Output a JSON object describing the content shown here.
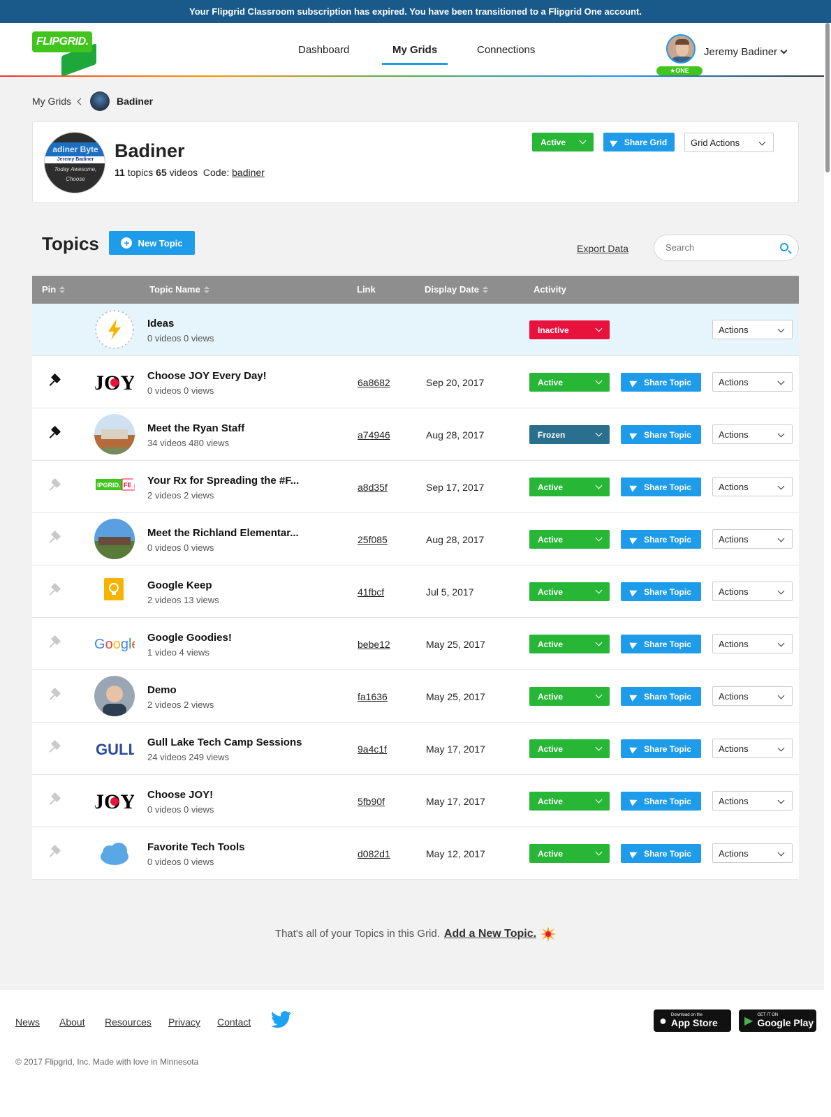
{
  "banner": {
    "text": "Your Flipgrid Classroom subscription has expired. You have been transitioned to a Flipgrid One account."
  },
  "header": {
    "logo": "FLIPGRID.",
    "nav": [
      {
        "label": "Dashboard",
        "active": false
      },
      {
        "label": "My Grids",
        "active": true
      },
      {
        "label": "Connections",
        "active": false
      }
    ],
    "user": {
      "name": "Jeremy Badiner",
      "badge": "★ONE"
    }
  },
  "breadcrumb": {
    "root": "My Grids",
    "current": "Badiner"
  },
  "grid": {
    "title": "Badiner",
    "topics_count": "11",
    "topics_label": "topics",
    "videos_count": "65",
    "videos_label": "videos",
    "code_label": "Code:",
    "code": "badiner",
    "avatar_line1": "adiner Byte",
    "avatar_line2": "Jeremy Badiner",
    "avatar_line3": "Today Awesome, Choose",
    "status": "Active",
    "share_label": "Share Grid",
    "actions_label": "Grid Actions"
  },
  "topics_section": {
    "title": "Topics",
    "new_topic_label": "New Topic",
    "export_label": "Export Data",
    "search_placeholder": "Search",
    "columns": {
      "pin": "Pin",
      "name": "Topic Name",
      "link": "Link",
      "date": "Display Date",
      "activity": "Activity"
    },
    "share_label": "Share Topic",
    "actions_label": "Actions"
  },
  "topics": [
    {
      "name": "Ideas",
      "sub": "0 videos 0 views",
      "link": "",
      "date": "",
      "status": "Inactive",
      "pinned": false,
      "thumb": "lightning-icon",
      "share": false
    },
    {
      "name": "Choose JOY Every Day!",
      "sub": "0 videos 0 views",
      "link": "6a8682",
      "date": "Sep 20, 2017",
      "status": "Active",
      "pinned": true,
      "thumb": "joy-text",
      "share": true
    },
    {
      "name": "Meet the Ryan Staff",
      "sub": "34 videos 480 views",
      "link": "a74946",
      "date": "Aug 28, 2017",
      "status": "Frozen",
      "pinned": true,
      "thumb": "school-photo",
      "share": true
    },
    {
      "name": "Your Rx for Spreading the #F...",
      "sub": "2 videos 2 views",
      "link": "a8d35f",
      "date": "Sep 17, 2017",
      "status": "Active",
      "pinned": false,
      "thumb": "flipgrid-logo",
      "share": true
    },
    {
      "name": "Meet the Richland Elementar...",
      "sub": "0 videos 0 views",
      "link": "25f085",
      "date": "Aug 28, 2017",
      "status": "Active",
      "pinned": false,
      "thumb": "building-photo",
      "share": true
    },
    {
      "name": "Google Keep",
      "sub": "2 videos 13 views",
      "link": "41fbcf",
      "date": "Jul 5, 2017",
      "status": "Active",
      "pinned": false,
      "thumb": "keep-icon",
      "share": true
    },
    {
      "name": "Google Goodies!",
      "sub": "1 video 4 views",
      "link": "bebe12",
      "date": "May 25, 2017",
      "status": "Active",
      "pinned": false,
      "thumb": "google-logo",
      "share": true
    },
    {
      "name": "Demo",
      "sub": "2 videos 2 views",
      "link": "fa1636",
      "date": "May 25, 2017",
      "status": "Active",
      "pinned": false,
      "thumb": "person-photo",
      "share": true
    },
    {
      "name": "Gull Lake Tech Camp Sessions",
      "sub": "24 videos 249 views",
      "link": "9a4c1f",
      "date": "May 17, 2017",
      "status": "Active",
      "pinned": false,
      "thumb": "gull-lake-logo",
      "share": true
    },
    {
      "name": "Choose JOY!",
      "sub": "0 videos 0 views",
      "link": "5fb90f",
      "date": "May 17, 2017",
      "status": "Active",
      "pinned": false,
      "thumb": "joy-text",
      "share": true
    },
    {
      "name": "Favorite Tech Tools",
      "sub": "0 videos 0 views",
      "link": "d082d1",
      "date": "May 12, 2017",
      "status": "Active",
      "pinned": false,
      "thumb": "cloud-icon",
      "share": true
    }
  ],
  "end_message": {
    "text": "That's all of your Topics in this Grid.",
    "link": "Add a New Topic."
  },
  "footer": {
    "links": [
      "News",
      "About",
      "Resources",
      "Privacy",
      "Contact"
    ],
    "app_store_small": "Download on the",
    "app_store_big": "App Store",
    "google_play_small": "GET IT ON",
    "google_play_big": "Google Play",
    "copyright": "© 2017 Flipgrid, Inc. Made with love in Minnesota"
  },
  "colors": {
    "active": "#28b637",
    "inactive": "#e8123d",
    "frozen": "#2a6f8d",
    "accent": "#1e9be9",
    "banner": "#1a5a8a"
  }
}
